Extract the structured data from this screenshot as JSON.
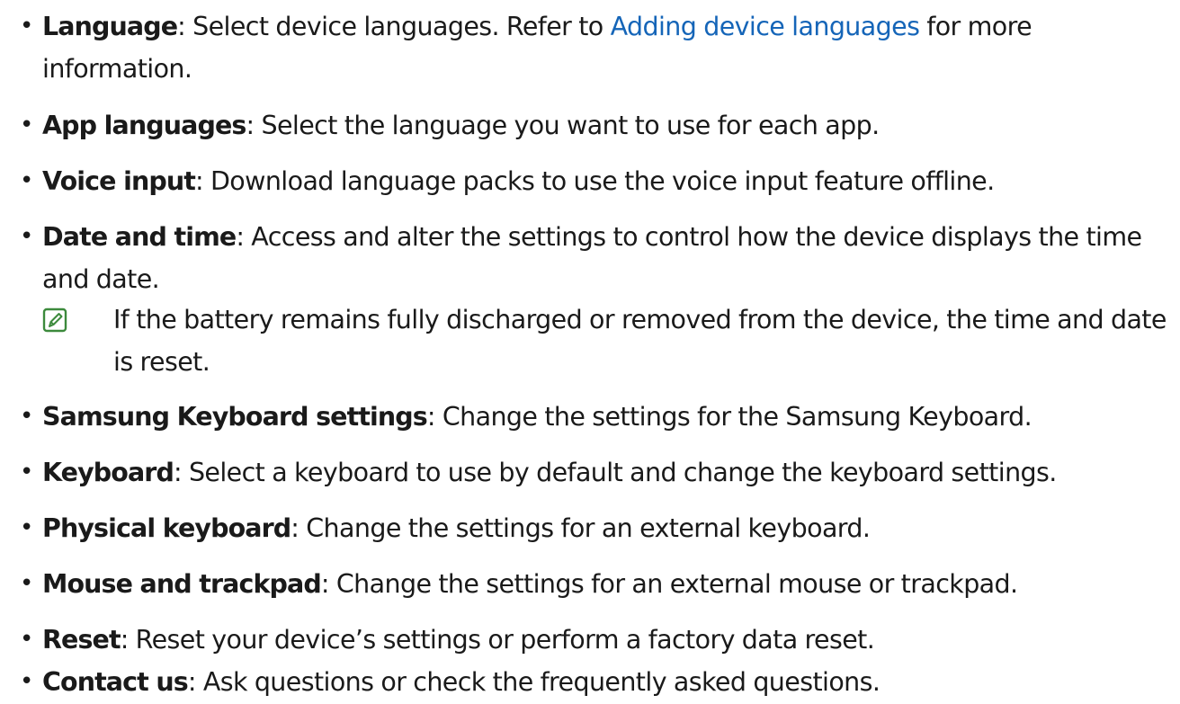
{
  "items": [
    {
      "term": "Language",
      "sep": ": ",
      "pre": "Select device languages. Refer to ",
      "link": "Adding device languages",
      "post": " for more information."
    },
    {
      "term": "App languages",
      "sep": ": ",
      "desc": "Select the language you want to use for each app."
    },
    {
      "term": "Voice input",
      "sep": ": ",
      "desc": "Download language packs to use the voice input feature offline."
    },
    {
      "term": "Date and time",
      "sep": ": ",
      "desc": "Access and alter the settings to control how the device displays the time and date."
    },
    {
      "term": "Samsung Keyboard settings",
      "sep": ": ",
      "desc": "Change the settings for the Samsung Keyboard."
    },
    {
      "term": "Keyboard",
      "sep": ": ",
      "desc": "Select a keyboard to use by default and change the keyboard settings."
    },
    {
      "term": "Physical keyboard",
      "sep": ": ",
      "desc": "Change the settings for an external keyboard."
    },
    {
      "term": "Mouse and trackpad",
      "sep": ": ",
      "desc": "Change the settings for an external mouse or trackpad."
    },
    {
      "term": "Reset",
      "sep": ": ",
      "desc": "Reset your device’s settings or perform a factory data reset."
    },
    {
      "term": "Contact us",
      "sep": ": ",
      "desc": "Ask questions or check the frequently asked questions."
    }
  ],
  "note": {
    "icon": "note-icon",
    "text": "If the battery remains fully discharged or removed from the device, the time and date is reset."
  },
  "colors": {
    "text": "#1a1a1a",
    "link": "#1565b8",
    "note_icon": "#3c8a3c"
  }
}
